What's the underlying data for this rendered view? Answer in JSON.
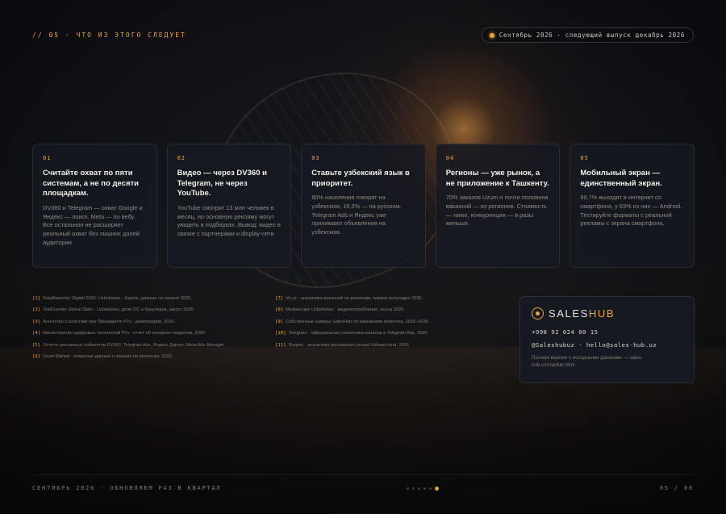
{
  "header": {
    "section": "// 05 · что из этого следует",
    "date_pill": "Сентябрь 2026 · следующий выпуск декабрь 2026",
    "accent_color": "#e9a53c"
  },
  "cards": [
    {
      "num": "01",
      "title": "Считайте охват по пяти системам, а не по десяти площадкам.",
      "text": "DV360 и Telegram — охват Google и Яндекс — поиск. Meta — по вебу. Все остальное не расширяет реальный охват без лишних долей аудитории."
    },
    {
      "num": "02",
      "title": "Видео — через DV360 и Telegram, не через YouTube.",
      "text": "YouTube смотрят 13 млн человек в месяц, но основную рекламу могут увидеть в подборках. Вывод: видео в связке с партнерами и display-сети"
    },
    {
      "num": "03",
      "title": "Ставьте узбекский язык в приоритет.",
      "text": "80% населения говорят на узбекском, 19,3% — на русском. Telegram Ads и Яндекс уже принимают объявления на узбекском."
    },
    {
      "num": "04",
      "title": "Регионы — уже рынок, а не приложение к Ташкенту.",
      "text": "70% заказов Uzum и почти половина вакансий — из регионов. Стоимость — ниже, конкуренция — в разы меньше."
    },
    {
      "num": "05",
      "title": "Мобильный экран — единственный экран.",
      "text": "99,7% выходят в интернет со смартфона, у 83% из них — Android. Тестируйте форматы с реальной рекламы с экрана смартфона."
    }
  ],
  "sources_col1": [
    {
      "n": "[1]",
      "text": "DataReportal, Digital 2026: Uzbekistan · Kepios, данные на начало 2026."
    },
    {
      "n": "[2]",
      "text": "StatCounter Global Stats · Uzbekistan, доли ОС и браузеров, август 2026."
    },
    {
      "n": "[3]",
      "text": "Агентство статистики при Президенте РУз · демография, 2026."
    },
    {
      "n": "[4]",
      "text": "Министерство цифровых технологий РУз · отчет об интернет-покрытии, 2026."
    },
    {
      "n": "[5]",
      "text": "Отчеты рекламных кабинетов DV360, Telegram Ads, Яндекс Директ, Meta Ads Manager."
    },
    {
      "n": "[6]",
      "text": "Uzum Market · открытые данные о заказах по регионам, 2026."
    }
  ],
  "sources_col2": [
    {
      "n": "[7]",
      "text": "hh.uz · аналитика вакансий по регионам, первое полугодие 2026."
    },
    {
      "n": "[8]",
      "text": "Mediascope Uzbekistan · медиапотребление, весна 2026."
    },
    {
      "n": "[9]",
      "text": "Собственные замеры SalesHub по кампаниям клиентов, 2025–2026."
    },
    {
      "n": "[10]",
      "text": "Telegram · официальная статистика каналов и Telegram Ads, 2026."
    },
    {
      "n": "[11]",
      "text": "Яндекс · аналитика рекламного рынка Узбекистана, 2026."
    }
  ],
  "contact": {
    "brand_prefix": "SALES",
    "brand_suffix": "HUB",
    "phone": "+998 92 024 00 15",
    "handles": "@Saleshubuz · hello@sales-hub.uz",
    "note": "Полная версия с исходными данными — sales-hub.uz/market.html"
  },
  "footer": {
    "left": "Сентябрь 2026 · обновляем раз в квартал",
    "right": "05 / 06",
    "pages_total": 6,
    "page_current": 6
  }
}
